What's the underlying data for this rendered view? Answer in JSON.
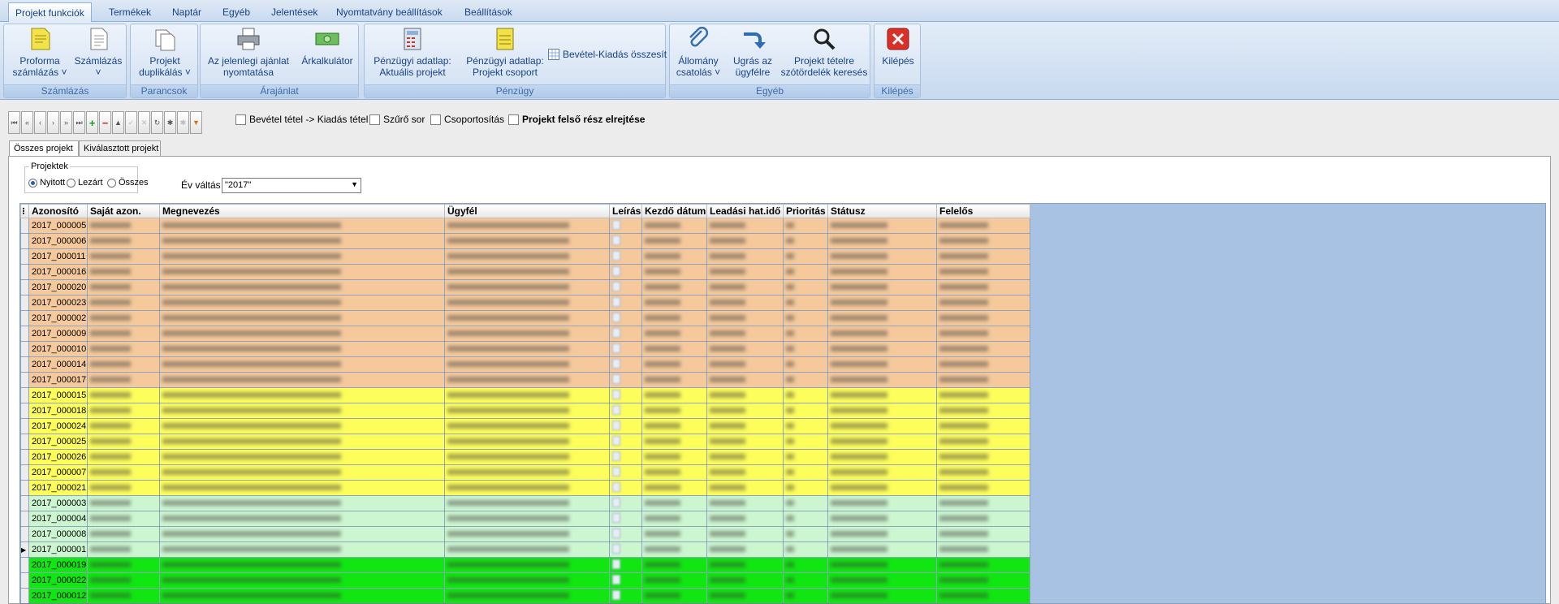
{
  "tabs": [
    "Projekt funkciók",
    "Termékek",
    "Naptár",
    "Egyéb",
    "Jelentések",
    "Nyomtatvány beállítások",
    "Beállítások"
  ],
  "groups": {
    "szamlazas": "Számlázás",
    "parancsok": "Parancsok",
    "arajanlat": "Árajánlat",
    "penzugy": "Pénzügy",
    "egyeb": "Egyéb",
    "kilepes": "Kilépés"
  },
  "buttons": {
    "proforma": [
      "Proforma",
      "számlázás ˅"
    ],
    "szamlazas": [
      "Számlázás",
      "˅"
    ],
    "duplikalas": [
      "Projekt",
      "duplikálás ˅"
    ],
    "nyomtatas": [
      "Az jelenlegi ajánlat",
      "nyomtatása"
    ],
    "arkalkulator": [
      "Árkalkulátor",
      ""
    ],
    "penz_aktualis": [
      "Pénzügyi adatlap:",
      "Aktuális projekt"
    ],
    "penz_csoport": [
      "Pénzügyi adatlap:",
      "Projekt csoport"
    ],
    "bevetel_kiadas": "Bevétel-Kiadás összesít",
    "allomany": [
      "Állomány",
      "csatolás ˅"
    ],
    "ugras": [
      "Ugrás az",
      "ügyfélre"
    ],
    "kereses": [
      "Projekt tételre",
      "szótördelék keresés"
    ],
    "kilepes": [
      "Kilépés",
      ""
    ]
  },
  "toolbar_checks": [
    "Bevétel tétel -> Kiadás tétel",
    "Szűrő sor",
    "Csoportosítás",
    "Projekt felső rész elrejtése"
  ],
  "content_tabs": [
    "Összes projekt",
    "Kiválasztott projekt"
  ],
  "filter": {
    "legend": "Projektek",
    "options": [
      "Nyitott",
      "Lezárt",
      "Összes"
    ],
    "year_label": "Év váltás",
    "year_value": "\"2017\""
  },
  "columns": [
    "Azonosító",
    "Saját azon.",
    "Megnevezés",
    "Ügyfél",
    "Leírás",
    "Kezdő dátum",
    "Leadási hat.idő",
    "Prioritás",
    "Státusz",
    "Felelős"
  ],
  "rows": [
    {
      "id": "2017_000005",
      "c": "or"
    },
    {
      "id": "2017_000006",
      "c": "or"
    },
    {
      "id": "2017_000011",
      "c": "or"
    },
    {
      "id": "2017_000016",
      "c": "or"
    },
    {
      "id": "2017_000020",
      "c": "or"
    },
    {
      "id": "2017_000023",
      "c": "or"
    },
    {
      "id": "2017_000002",
      "c": "or"
    },
    {
      "id": "2017_000009",
      "c": "or"
    },
    {
      "id": "2017_000010",
      "c": "or"
    },
    {
      "id": "2017_000014",
      "c": "or"
    },
    {
      "id": "2017_000017",
      "c": "or"
    },
    {
      "id": "2017_000015",
      "c": "ye"
    },
    {
      "id": "2017_000018",
      "c": "ye"
    },
    {
      "id": "2017_000024",
      "c": "ye"
    },
    {
      "id": "2017_000025",
      "c": "ye"
    },
    {
      "id": "2017_000026",
      "c": "ye"
    },
    {
      "id": "2017_000007",
      "c": "ye"
    },
    {
      "id": "2017_000021",
      "c": "ye"
    },
    {
      "id": "2017_000003",
      "c": "lg"
    },
    {
      "id": "2017_000004",
      "c": "lg"
    },
    {
      "id": "2017_000008",
      "c": "lg"
    },
    {
      "id": "2017_000001",
      "c": "lg"
    },
    {
      "id": "2017_000019",
      "c": "gr"
    },
    {
      "id": "2017_000022",
      "c": "gr"
    },
    {
      "id": "2017_000012",
      "c": "gr"
    }
  ]
}
